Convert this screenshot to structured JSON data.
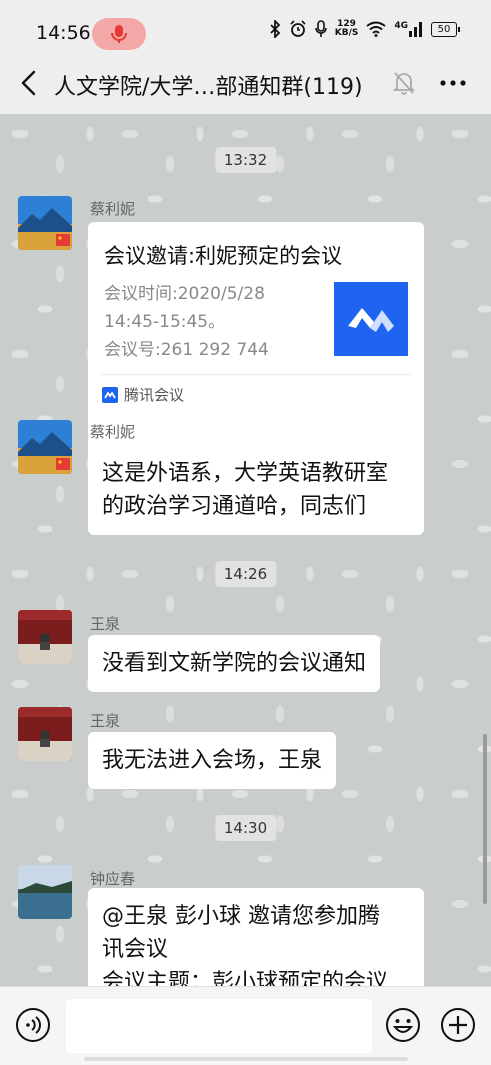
{
  "status_bar": {
    "time": "14:56",
    "speed_value": "129",
    "speed_unit": "KB/S",
    "network": "4G",
    "battery": "50"
  },
  "header": {
    "title": "人文学院/大学…部通知群(119)"
  },
  "chat": {
    "timestamps": [
      "13:32",
      "14:26",
      "14:30"
    ],
    "messages": [
      {
        "sender": "蔡利妮",
        "card": {
          "title": "会议邀请:利妮预定的会议",
          "line1": "会议时间:2020/5/28",
          "line2": "14:45-15:45。",
          "line3": "会议号:261 292 744",
          "source": "腾讯会议"
        }
      },
      {
        "sender": "蔡利妮",
        "line1": "这是外语系，大学英语教研室",
        "line2": "的政治学习通道哈，同志们"
      },
      {
        "sender": "王泉",
        "text": "没看到文新学院的会议通知"
      },
      {
        "sender": "王泉",
        "text": "我无法进入会场，王泉"
      },
      {
        "sender": "钟应春",
        "line1": "@王泉  彭小球 邀请您参加腾",
        "line2": "讯会议",
        "line3": "会议主题：彭小球预定的会议"
      }
    ]
  },
  "colors": {
    "accent_meeting": "#1f63f1",
    "mic_pill": "#f4a7a7"
  }
}
